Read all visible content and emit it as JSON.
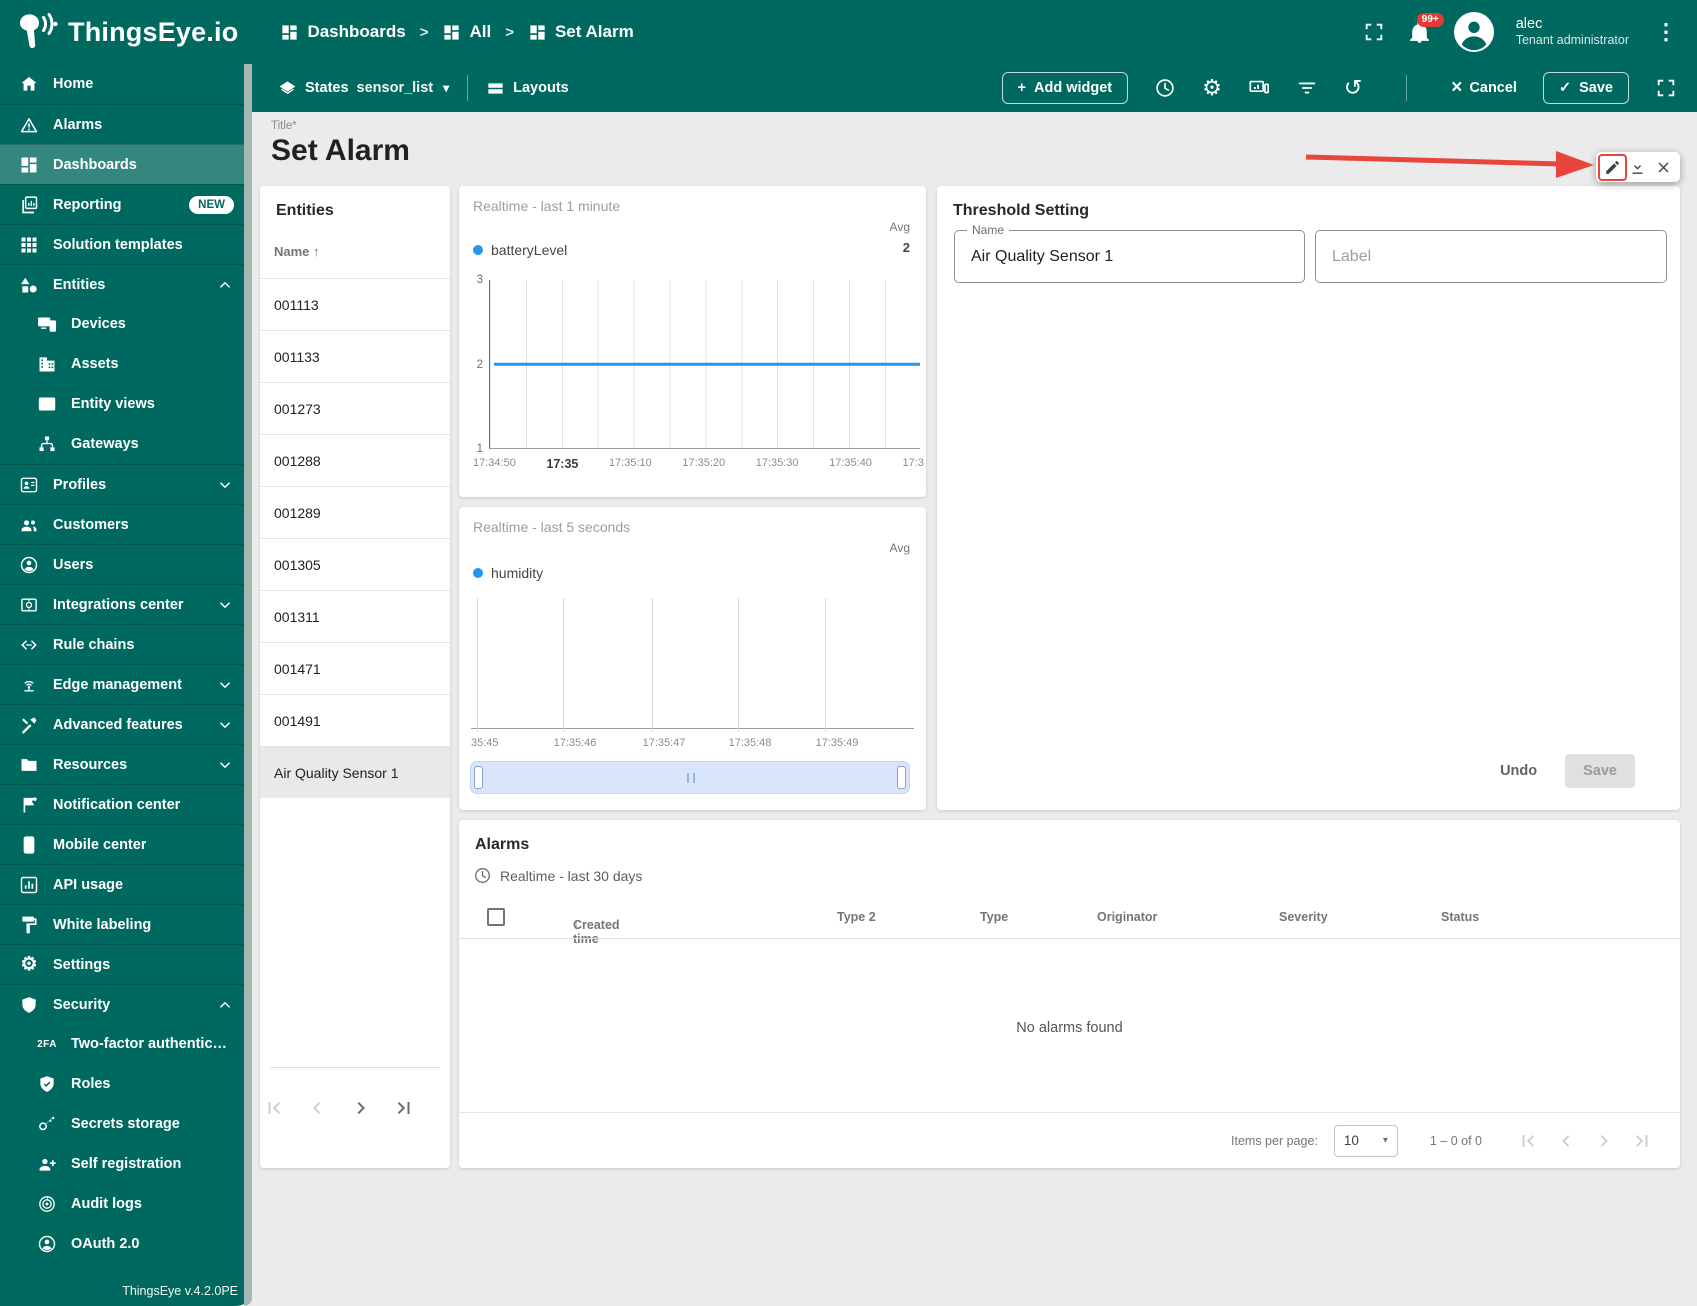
{
  "app": {
    "brand": "ThingsEye.io",
    "version": "ThingsEye v.4.2.0PE"
  },
  "colors": {
    "brand_teal": "#00695f",
    "accent_blue": "#2196f3",
    "annotation_red": "#e8463c",
    "badge_red": "#e53935",
    "content_bg": "#ebebeb",
    "selected_row_bg": "#e9e9e9"
  },
  "icons": {
    "settings_glyph": "⚙",
    "history_glyph": "↺",
    "kebab_glyph": "⋮",
    "cancel_glyph": "×",
    "check_glyph": "✓",
    "plus_glyph": "+",
    "sort_asc_glyph": "↑",
    "sort_desc_glyph": "↓",
    "caret_down_glyph": "▾",
    "breadcrumb_separator": ">",
    "twofa_text": "2FA"
  },
  "header": {
    "breadcrumbs": [
      "Dashboards",
      "All",
      "Set Alarm"
    ],
    "notifications_badge": "99+",
    "user_name": "alec",
    "user_role": "Tenant administrator"
  },
  "toolbar": {
    "states_label": "States",
    "states_value": "sensor_list",
    "layouts_label": "Layouts",
    "add_widget_label": "Add widget",
    "cancel_label": "Cancel",
    "save_label": "Save"
  },
  "sidebar": {
    "items": [
      {
        "label": "Home",
        "icon": "home"
      },
      {
        "label": "Alarms",
        "icon": "warning"
      },
      {
        "label": "Dashboards",
        "icon": "dashboards",
        "active": true
      },
      {
        "label": "Reporting",
        "icon": "reporting",
        "badge": "NEW"
      },
      {
        "label": "Solution templates",
        "icon": "apps-grid"
      },
      {
        "label": "Entities",
        "icon": "entities",
        "expanded": true
      },
      {
        "label": "Devices",
        "icon": "devices"
      },
      {
        "label": "Assets",
        "icon": "building"
      },
      {
        "label": "Entity views",
        "icon": "entity-views"
      },
      {
        "label": "Gateways",
        "icon": "lan"
      },
      {
        "label": "Profiles",
        "icon": "badge",
        "collapsible": true
      },
      {
        "label": "Customers",
        "icon": "people"
      },
      {
        "label": "Users",
        "icon": "person-circle"
      },
      {
        "label": "Integrations center",
        "icon": "integration",
        "collapsible": true
      },
      {
        "label": "Rule chains",
        "icon": "rule-chain"
      },
      {
        "label": "Edge management",
        "icon": "antenna",
        "collapsible": true
      },
      {
        "label": "Advanced features",
        "icon": "tools",
        "collapsible": true
      },
      {
        "label": "Resources",
        "icon": "folder",
        "collapsible": true
      },
      {
        "label": "Notification center",
        "icon": "flag"
      },
      {
        "label": "Mobile center",
        "icon": "smartphone"
      },
      {
        "label": "API usage",
        "icon": "bar-chart"
      },
      {
        "label": "White labeling",
        "icon": "paint"
      },
      {
        "label": "Settings",
        "icon": "gear"
      },
      {
        "label": "Security",
        "icon": "shield",
        "expanded": true
      },
      {
        "label": "Two-factor authenticati…",
        "icon": "2fa"
      },
      {
        "label": "Roles",
        "icon": "shield-check"
      },
      {
        "label": "Secrets storage",
        "icon": "key"
      },
      {
        "label": "Self registration",
        "icon": "person-add"
      },
      {
        "label": "Audit logs",
        "icon": "track-changes"
      },
      {
        "label": "OAuth 2.0",
        "icon": "person-circle"
      }
    ]
  },
  "dashboard": {
    "title_label": "Title*",
    "title_value": "Set Alarm"
  },
  "entities_widget": {
    "title": "Entities",
    "column_header": "Name",
    "rows": [
      "001113",
      "001133",
      "001273",
      "001288",
      "001289",
      "001305",
      "001311",
      "001471",
      "001491",
      "Air Quality Sensor 1"
    ],
    "selected_row": "Air Quality Sensor 1"
  },
  "chart_data": [
    {
      "type": "line",
      "title": "Realtime - last 1 minute",
      "agg_header": "Avg",
      "series": [
        {
          "name": "batteryLevel",
          "color": "#2196f3",
          "avg": "2",
          "constant_value": 2
        }
      ],
      "ylim": [
        1,
        3
      ],
      "y_ticks": [
        "3",
        "2",
        "1"
      ],
      "x_ticks": [
        "17:34:50",
        "17:35",
        "17:35:10",
        "17:35:20",
        "17:35:30",
        "17:35:40",
        "17:3"
      ],
      "bold_x_tick": "17:35",
      "grid": "vertical"
    },
    {
      "type": "line",
      "title": "Realtime - last 5 seconds",
      "agg_header": "Avg",
      "series": [
        {
          "name": "humidity",
          "color": "#2196f3",
          "avg": "",
          "values": []
        }
      ],
      "x_ticks": [
        "35:45",
        "17:35:46",
        "17:35:47",
        "17:35:48",
        "17:35:49"
      ],
      "grid": "vertical",
      "note": "no data plotted"
    }
  ],
  "threshold_widget": {
    "title": "Threshold Setting",
    "name_label": "Name",
    "name_value": "Air Quality Sensor 1",
    "label_placeholder": "Label",
    "undo_label": "Undo",
    "save_label": "Save"
  },
  "alarms_widget": {
    "title": "Alarms",
    "subtitle": "Realtime - last 30 days",
    "columns": [
      "Created time",
      "Type 2",
      "Type",
      "Originator",
      "Severity",
      "Status"
    ],
    "empty_text": "No alarms found",
    "items_per_page_label": "Items per page:",
    "items_per_page_value": "10",
    "range_text": "1 – 0 of 0"
  }
}
